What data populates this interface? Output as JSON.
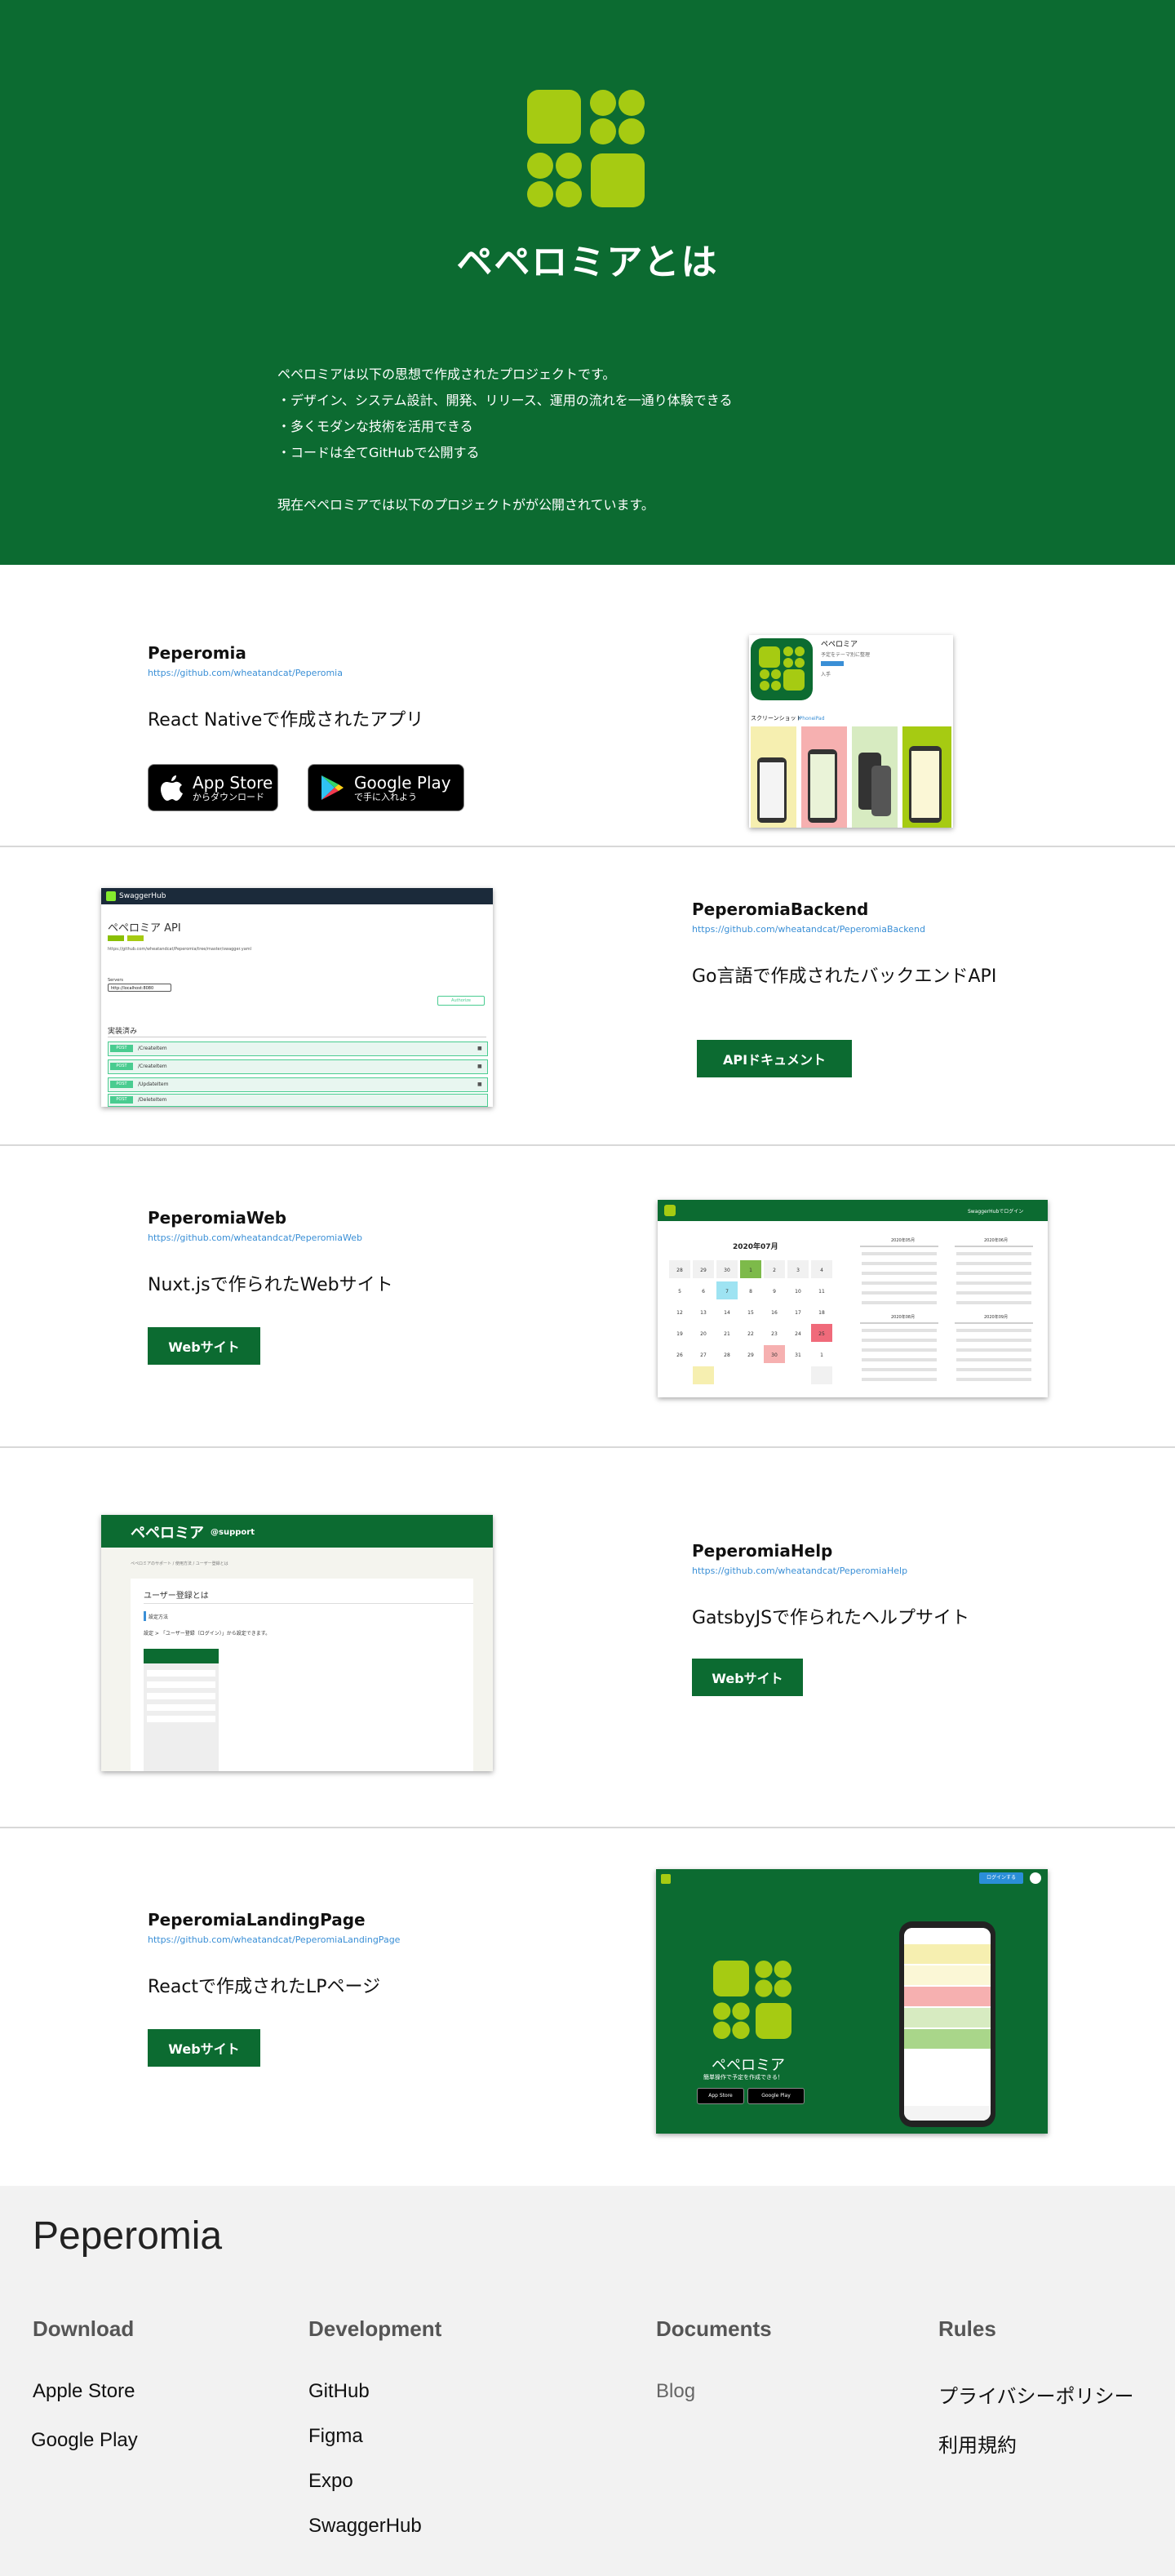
{
  "hero": {
    "title": "ペペロミアとは",
    "lines": [
      "ペペロミアは以下の思想で作成されたプロジェクトです。",
      "・デザイン、システム設計、開発、リリース、運用の流れを一通り体験できる",
      "・多くモダンな技術を活用できる",
      "・コードは全てGitHubで公開する",
      "現在ペペロミアでは以下のプロジェクトがが公開されています。"
    ]
  },
  "projects": [
    {
      "name": "Peperomia",
      "url": "https://github.com/wheatandcat/Peperomia",
      "description": "React Nativeで作成されたアプリ",
      "app_store": {
        "big": "App Store",
        "small": "からダウンロード"
      },
      "google_play": {
        "big": "Google Play",
        "small": "で手に入れよう"
      }
    },
    {
      "name": "PeperomiaBackend",
      "url": "https://github.com/wheatandcat/PeperomiaBackend",
      "description": "Go言語で作成されたバックエンドAPI",
      "button": "APIドキュメント"
    },
    {
      "name": "PeperomiaWeb",
      "url": "https://github.com/wheatandcat/PeperomiaWeb",
      "description": "Nuxt.jsで作られたWebサイト",
      "button": "Webサイト"
    },
    {
      "name": "PeperomiaHelp",
      "url": "https://github.com/wheatandcat/PeperomiaHelp",
      "description": "GatsbyJSで作られたヘルプサイト",
      "button": "Webサイト"
    },
    {
      "name": "PeperomiaLandingPage",
      "url": "https://github.com/wheatandcat/PeperomiaLandingPage",
      "description": "Reactで作成されたLPページ",
      "button": "Webサイト"
    }
  ],
  "screenshots": {
    "app": {
      "app_name": "ペペロミア",
      "subtitle": "予定をテーマ別に整理",
      "open": "入手",
      "section": "スクリーンショット",
      "tab_iphone": "iPhone",
      "tab_ipad": "iPad"
    },
    "swagger": {
      "brand": "SwaggerHub",
      "title": "ペペロミア API",
      "url": "https://github.com/wheatandcat/Peperomia/tree/master/swagger.yaml",
      "servers_label": "Servers",
      "server": "http://localhost:8080",
      "auth": "Authorize",
      "section": "実装済み",
      "endpoints": [
        {
          "method": "POST",
          "path": "/CreateItem"
        },
        {
          "method": "POST",
          "path": "/CreateItem"
        },
        {
          "method": "POST",
          "path": "/UpdateItem"
        },
        {
          "method": "POST",
          "path": "/DeleteItem"
        }
      ]
    },
    "web": {
      "month": "2020年07月",
      "small_months": [
        "2020年05月",
        "2020年06月",
        "2020年08月",
        "2020年09月"
      ],
      "header_right": "SwaggerHubでログイン"
    },
    "help": {
      "brand": "ペペロミア",
      "brand_sub": "@support",
      "breadcrumb": "ペペロミアのサポート / 使用方法 / ユーザー登録とは",
      "heading": "ユーザー登録とは",
      "label": "設定方法",
      "text": "設定 > 「ユーザー登録（ログイン）」から設定できます。"
    },
    "lp": {
      "title": "ペペロミア",
      "subtitle": "簡単操作で予定を作成できる！",
      "login": "ログインする",
      "app_store": "App Store",
      "google_play": "Google Play"
    }
  },
  "footer": {
    "brand": "Peperomia",
    "columns": [
      {
        "heading": "Download",
        "items": [
          "Apple Store",
          "Google Play"
        ]
      },
      {
        "heading": "Development",
        "items": [
          "GitHub",
          "Figma",
          "Expo",
          "SwaggerHub"
        ]
      },
      {
        "heading": "Documents",
        "items": [
          "Blog"
        ]
      },
      {
        "heading": "Rules",
        "items": [
          "プライバシーポリシー",
          "利用規約"
        ]
      }
    ]
  },
  "colors": {
    "brand_green": "#0c6b31",
    "lime": "#a6cb12",
    "link": "#3a8fd6",
    "footer_bg": "#f2f2f2"
  }
}
